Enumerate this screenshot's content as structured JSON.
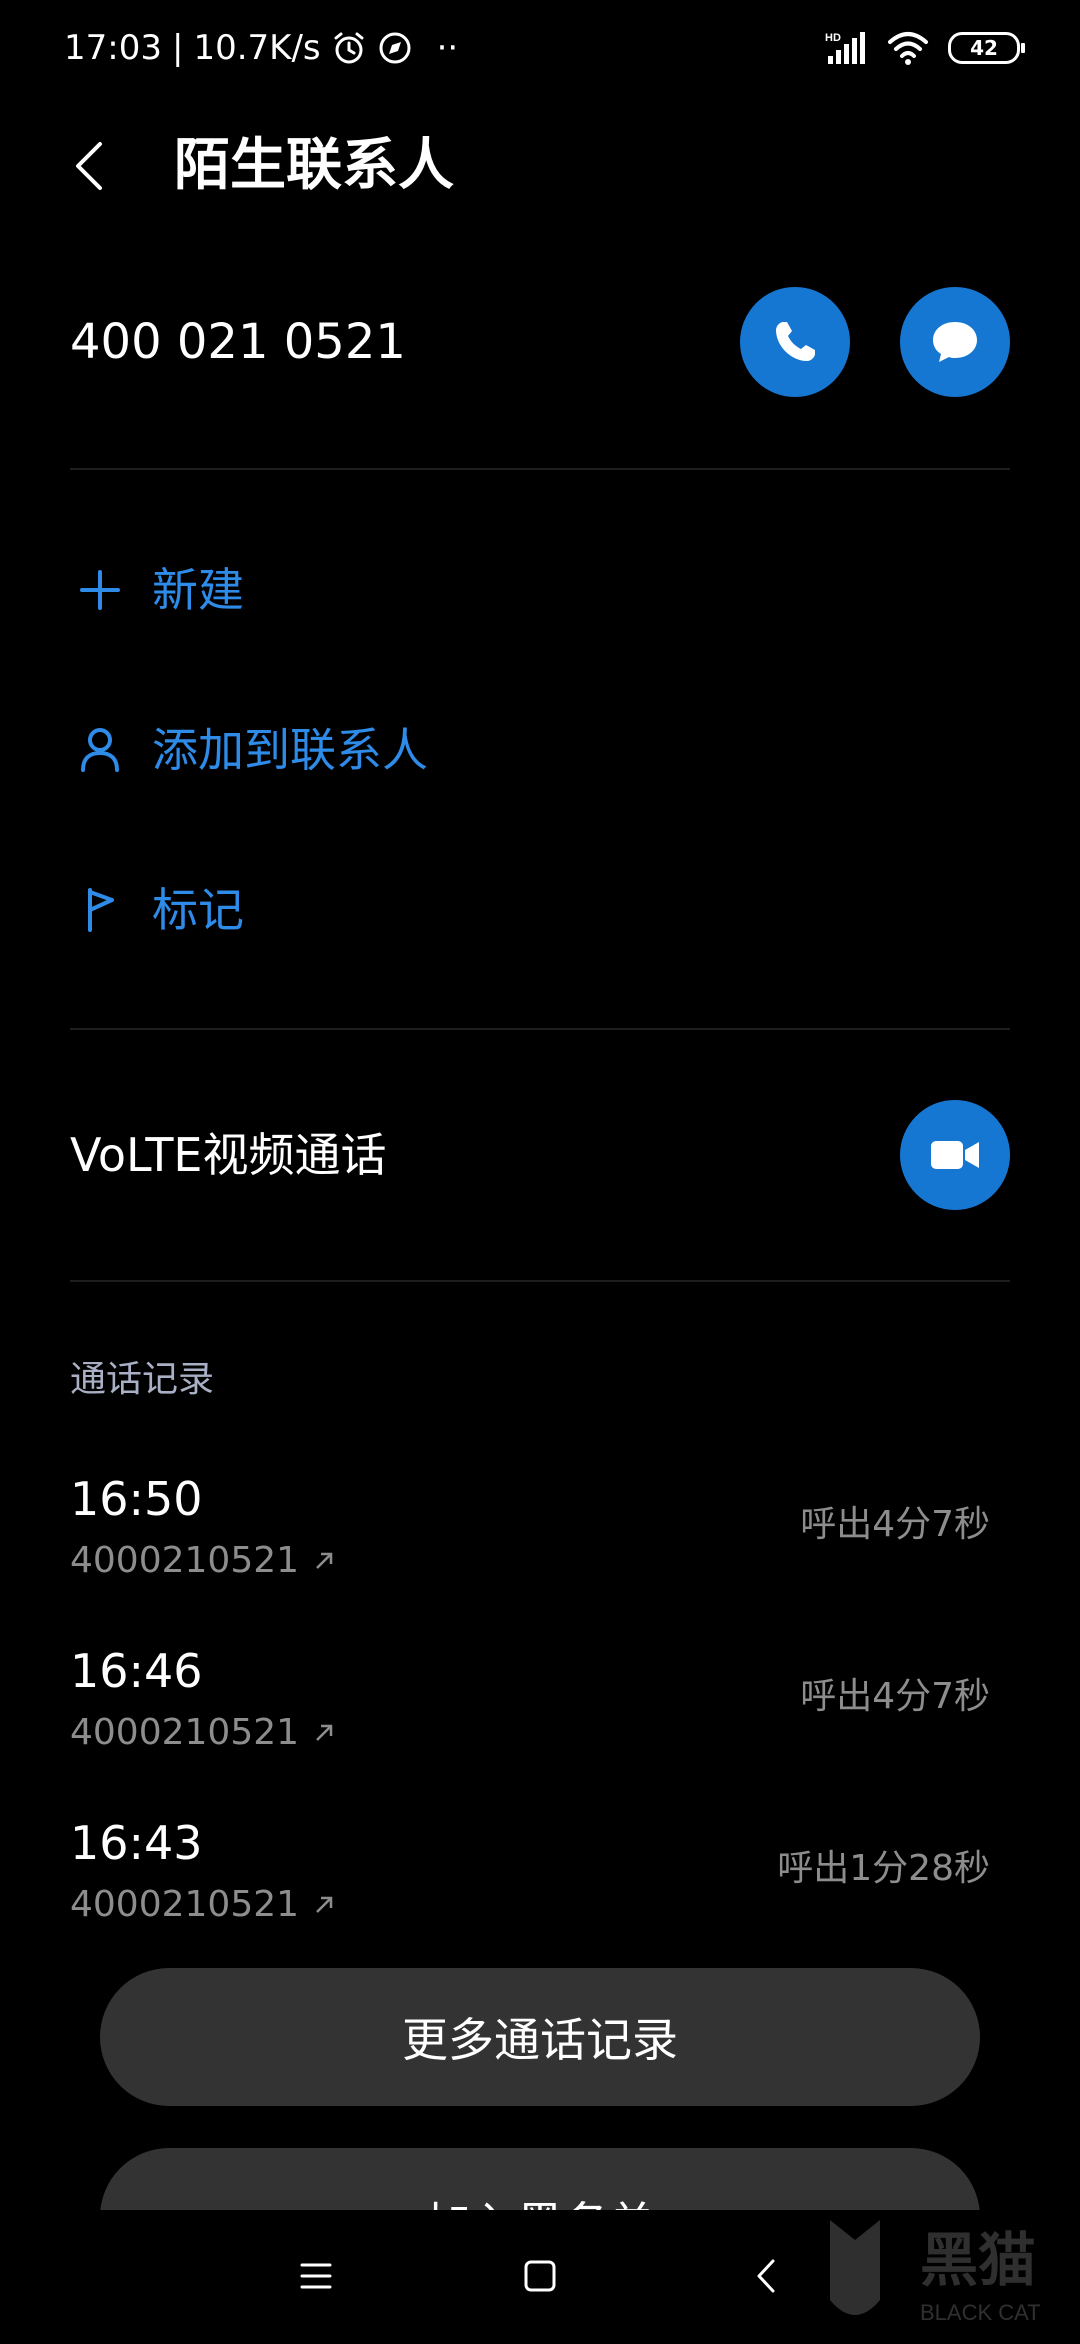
{
  "status_bar": {
    "time": "17:03",
    "separator": "|",
    "network_speed": "10.7K/s",
    "dots": "··",
    "network_badge": "HD",
    "battery": "42"
  },
  "header": {
    "title": "陌生联系人"
  },
  "contact": {
    "number": "400 021 0521"
  },
  "actions": [
    {
      "label": "新建",
      "icon": "plus-icon"
    },
    {
      "label": "添加到联系人",
      "icon": "person-icon"
    },
    {
      "label": "标记",
      "icon": "flag-icon"
    }
  ],
  "volte": {
    "label": "VoLTE视频通话"
  },
  "call_log": {
    "title": "通话记录",
    "items": [
      {
        "time": "16:50",
        "number": "4000210521",
        "duration": "呼出4分7秒"
      },
      {
        "time": "16:46",
        "number": "4000210521",
        "duration": "呼出4分7秒"
      },
      {
        "time": "16:43",
        "number": "4000210521",
        "duration": "呼出1分28秒"
      }
    ]
  },
  "buttons": {
    "more_calls": "更多通话记录",
    "block": "加入黑名单"
  },
  "watermark": {
    "text": "黑猫",
    "sub": "BLACK CAT"
  },
  "colors": {
    "accent": "#1677d2",
    "link": "#2e8be8",
    "background": "#000000",
    "pill": "#333333"
  }
}
